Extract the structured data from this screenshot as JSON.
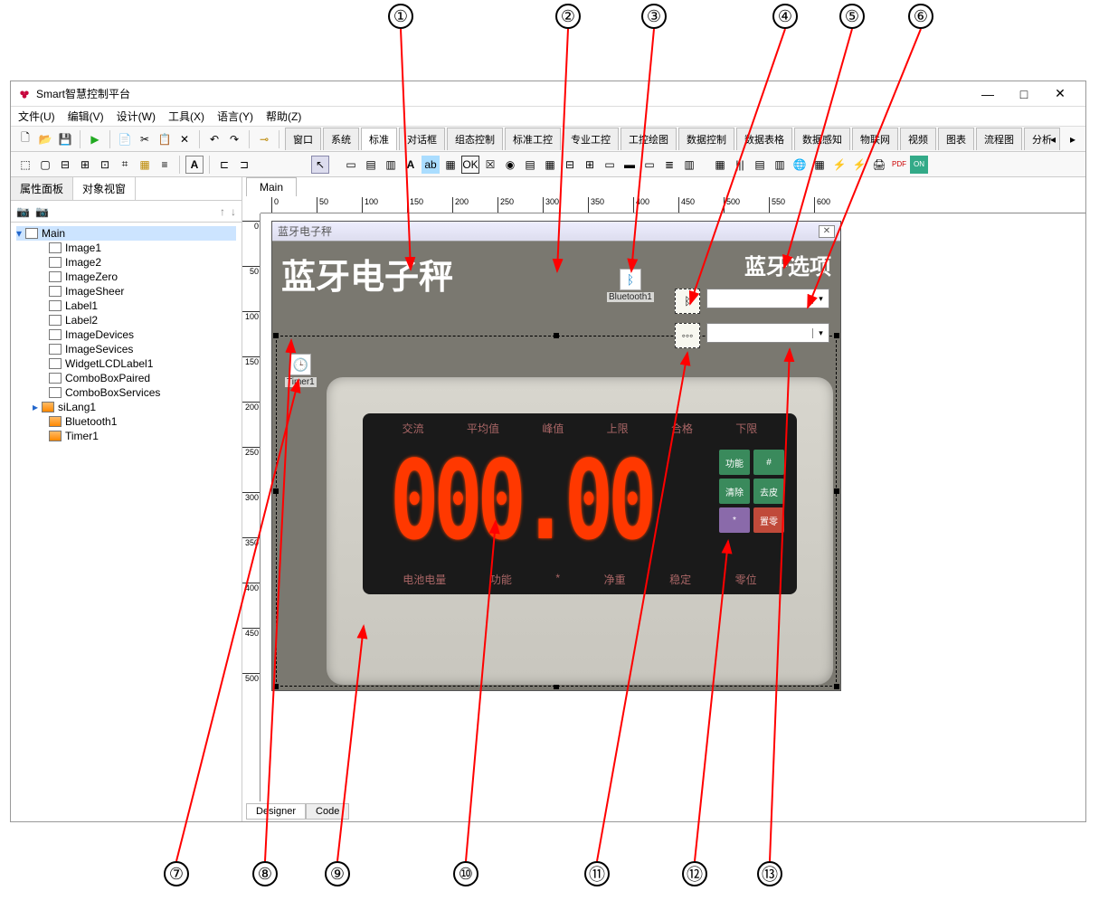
{
  "callouts": {
    "1": "①",
    "2": "②",
    "3": "③",
    "4": "④",
    "5": "⑤",
    "6": "⑥",
    "7": "⑦",
    "8": "⑧",
    "9": "⑨",
    "10": "⑩",
    "11": "⑪",
    "12": "⑫",
    "13": "⑬"
  },
  "window": {
    "title": "Smart智慧控制平台",
    "min": "—",
    "max": "□",
    "close": "✕"
  },
  "menu": {
    "file": "文件(U)",
    "edit": "编辑(V)",
    "design": "设计(W)",
    "tools": "工具(X)",
    "lang": "语言(Y)",
    "help": "帮助(Z)"
  },
  "comp_tabs": {
    "window": "窗口",
    "system": "系统",
    "standard": "标准",
    "dialog": "对话框",
    "group": "组态控制",
    "std_ctrl": "标准工控",
    "pro_ctrl": "专业工控",
    "draw": "工控绘图",
    "data_ctrl": "数据控制",
    "data_table": "数据表格",
    "data_sense": "数据感知",
    "iot": "物联网",
    "video": "视频",
    "chart": "图表",
    "flow": "流程图",
    "analysis": "分析"
  },
  "left": {
    "tab1": "属性面板",
    "tab2": "对象视窗"
  },
  "tree": {
    "root": "Main",
    "items": [
      "Image1",
      "Image2",
      "ImageZero",
      "ImageSheer",
      "Label1",
      "Label2",
      "ImageDevices",
      "ImageSevices",
      "WidgetLCDLabel1",
      "ComboBoxPaired",
      "ComboBoxServices",
      "siLang1",
      "Bluetooth1",
      "Timer1"
    ]
  },
  "design": {
    "tab": "Main",
    "bottom_tab1": "Designer",
    "bottom_tab2": "Code",
    "ruler_h": [
      "0",
      "50",
      "100",
      "150",
      "200",
      "250",
      "300",
      "350",
      "400",
      "450",
      "500",
      "550",
      "600"
    ],
    "ruler_v": [
      "0",
      "50",
      "100",
      "150",
      "200",
      "250",
      "300",
      "350",
      "400",
      "450",
      "500"
    ]
  },
  "form": {
    "title": "蓝牙电子秤",
    "big_title": "蓝牙电子秤",
    "opt_title": "蓝牙选项",
    "bluetooth_comp": "Bluetooth1",
    "timer_comp": "Timer1",
    "lcd_value": "000.00",
    "scale_top": [
      "交流",
      "平均值",
      "峰值",
      "上限",
      "合格",
      "下限"
    ],
    "scale_bot": [
      "电池电量",
      "功能",
      "*",
      "净重",
      "稳定",
      "零位"
    ],
    "keys": {
      "fn": "功能",
      "hash": "#",
      "clear": "清除",
      "tare": "去皮",
      "star": "*",
      "zero": "置零"
    }
  }
}
